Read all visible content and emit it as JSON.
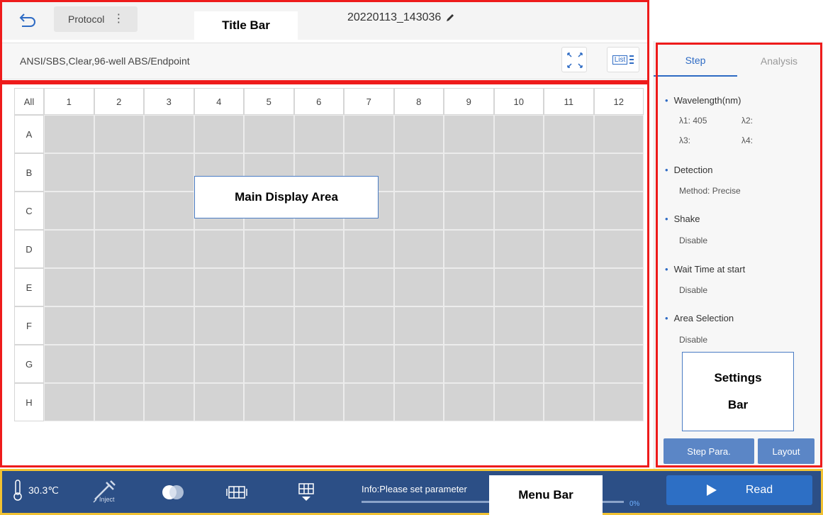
{
  "title_bar": {
    "protocol_label": "Protocol",
    "kebab": "⋮",
    "file_name": "20220113_143036"
  },
  "info_bar": {
    "plate_info": "ANSI/SBS,Clear,96-well  ABS/Endpoint",
    "list_label": "List"
  },
  "grid": {
    "all_label": "All",
    "columns": [
      "1",
      "2",
      "3",
      "4",
      "5",
      "6",
      "7",
      "8",
      "9",
      "10",
      "11",
      "12"
    ],
    "rows": [
      "A",
      "B",
      "C",
      "D",
      "E",
      "F",
      "G",
      "H"
    ]
  },
  "settings": {
    "tabs": [
      "Step",
      "Analysis"
    ],
    "wavelength_title": "Wavelength(nm)",
    "lambda1": "λ1: 405",
    "lambda2": "λ2:",
    "lambda3": "λ3:",
    "lambda4": "λ4:",
    "detection_title": "Detection",
    "detection_value": "Method: Precise",
    "shake_title": "Shake",
    "shake_value": "Disable",
    "wait_title": "Wait Time at start",
    "wait_value": "Disable",
    "area_title": "Area Selection",
    "area_value": "Disable",
    "step_para_button": "Step Para.",
    "layout_button": "Layout"
  },
  "menu_bar": {
    "temperature": "30.3℃",
    "inject_label": "Inject",
    "info_text": "Info:Please set parameter",
    "progress_percent": "0%",
    "progress_fraction": 0,
    "read_button": "Read"
  },
  "annotations": {
    "title_bar": "Title Bar",
    "main_display": "Main Display Area",
    "settings_line1": "Settings",
    "settings_line2": "Bar",
    "menu_bar": "Menu Bar"
  },
  "colors": {
    "accent": "#2e6bc4",
    "menu_bg": "#2c4f86",
    "well": "#d3d3d3",
    "annotation_red": "#ee1b1b",
    "annotation_yellow": "#f1c232"
  }
}
